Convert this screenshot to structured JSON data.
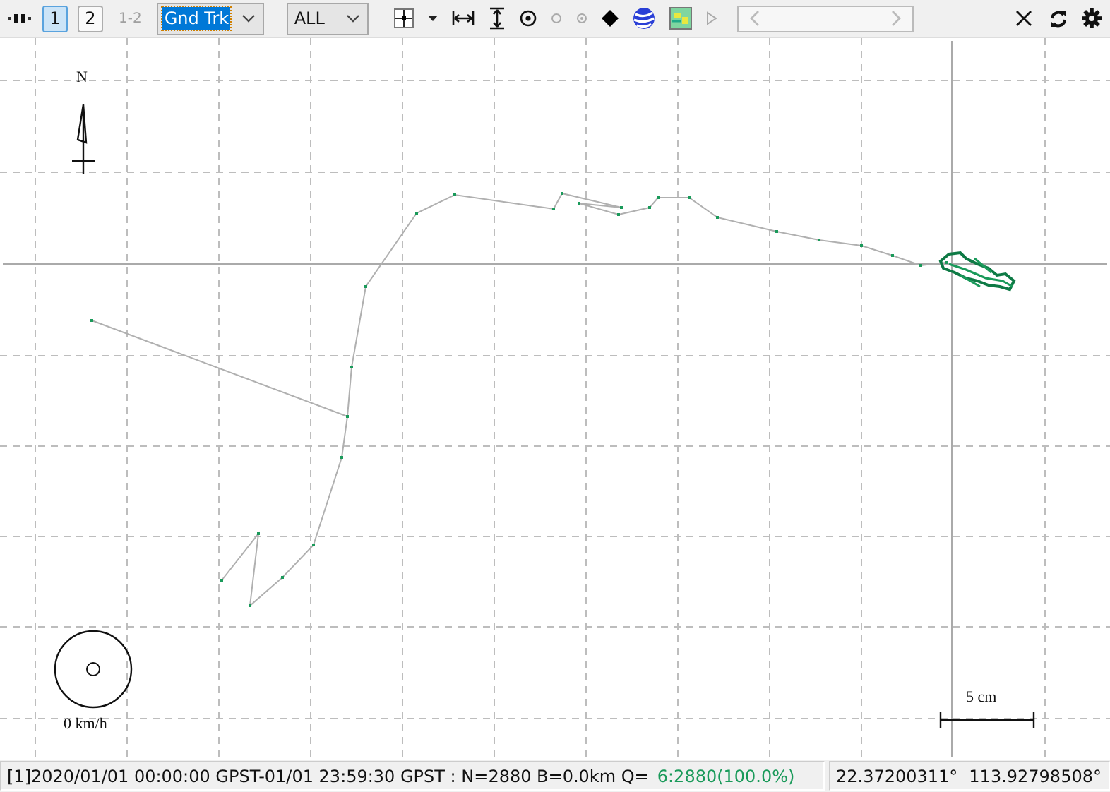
{
  "toolbar": {
    "plot_buttons": [
      {
        "label": "1",
        "selected": true,
        "disabled": false
      },
      {
        "label": "2",
        "selected": false,
        "disabled": false
      },
      {
        "label": "1-2",
        "selected": false,
        "disabled": true
      }
    ],
    "plot_type": {
      "value": "Gnd Trk"
    },
    "satellite_filter": {
      "value": "ALL"
    },
    "time_slider": {
      "level": 0
    }
  },
  "plot": {
    "north_label": "N",
    "speed_label": "0 km/h",
    "scale_label": "5 cm"
  },
  "status_bar": {
    "message": "[1]2020/01/01 00:00:00 GPST-01/01 23:59:30 GPST : N=2880 B=0.0km Q=",
    "quality": "6:2880(100.0%)",
    "latitude": "22.37200311°",
    "longitude": "113.92798508°"
  }
}
